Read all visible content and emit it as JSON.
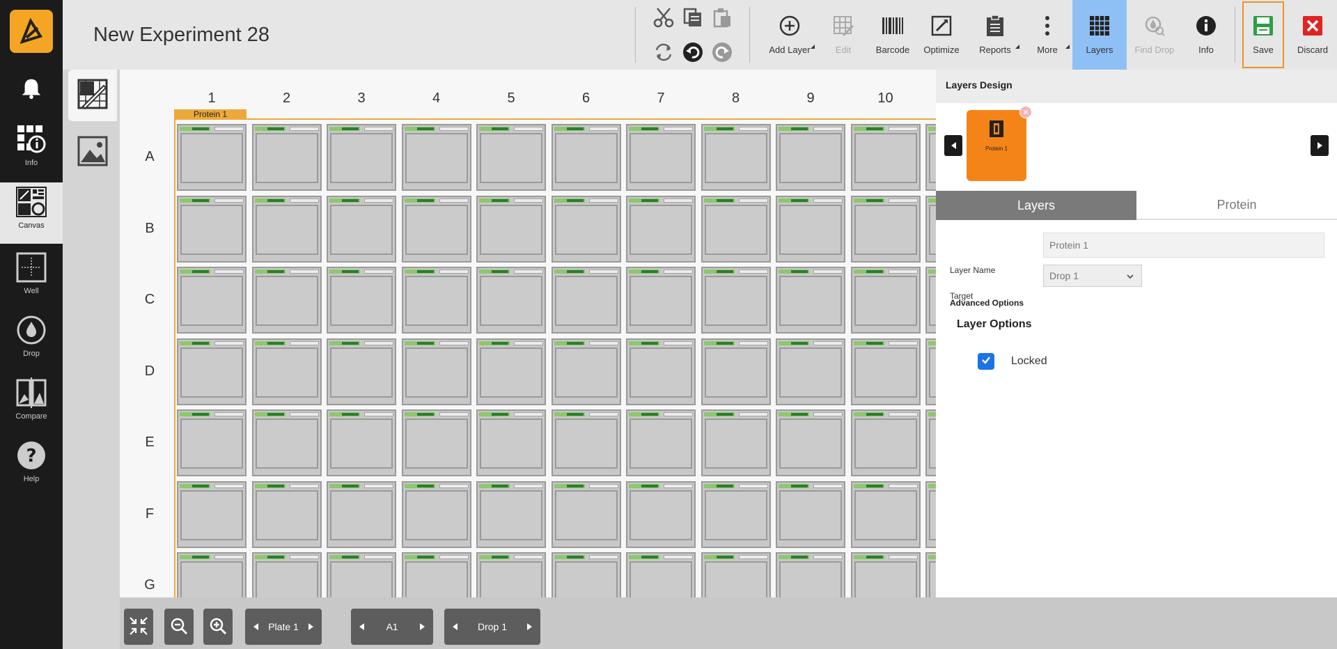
{
  "nav": {
    "items": [
      {
        "label": "Info"
      },
      {
        "label": "Canvas"
      },
      {
        "label": "Well"
      },
      {
        "label": "Drop"
      },
      {
        "label": "Compare"
      },
      {
        "label": "Help"
      }
    ]
  },
  "header": {
    "title": "New Experiment 28"
  },
  "toolbar": {
    "add_layer": "Add Layer",
    "edit": "Edit",
    "barcode": "Barcode",
    "optimize": "Optimize",
    "reports": "Reports",
    "more": "More",
    "layers": "Layers",
    "find_drop": "Find Drop",
    "info": "Info",
    "save": "Save",
    "discard": "Discard"
  },
  "plate": {
    "columns": [
      "1",
      "2",
      "3",
      "4",
      "5",
      "6",
      "7",
      "8",
      "9",
      "10"
    ],
    "rows": [
      "A",
      "B",
      "C",
      "D",
      "E",
      "F",
      "G"
    ],
    "layer_tag": "Protein 1"
  },
  "bottom": {
    "plate": "Plate 1",
    "well": "A1",
    "drop": "Drop 1"
  },
  "panel": {
    "title": "Layers Design",
    "card_label": "Protein 1",
    "tabs": [
      "Layers",
      "Protein"
    ],
    "layer_name_label": "Layer Name",
    "layer_name_value": "Protein 1",
    "target_label": "Target",
    "target_value": "Drop 1",
    "advanced_options": "Advanced Options",
    "layer_options": "Layer Options",
    "locked_label": "Locked",
    "locked_checked": true
  },
  "colors": {
    "accent_orange": "#f58418",
    "layer_outline": "#eca93a",
    "active_blue": "#8ec0f5",
    "save_green": "#2e9e44",
    "discard_red": "#e02424"
  }
}
